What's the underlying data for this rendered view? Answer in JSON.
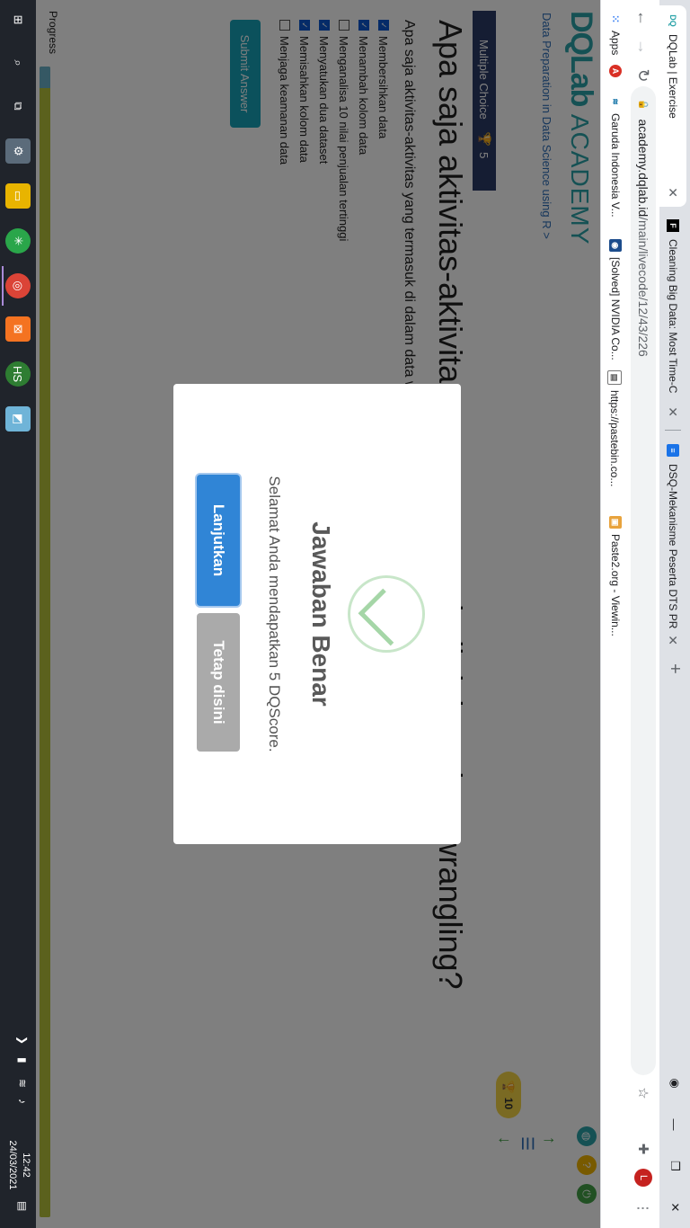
{
  "browser": {
    "tabs": [
      {
        "label": "DQLab | Exercise",
        "favicon": "DQ",
        "active": true
      },
      {
        "label": "Cleaning Big Data: Most Time-C",
        "favicon": "F",
        "active": false
      },
      {
        "label": "DSQ-Mekanisme Peserta DTS PR",
        "favicon": "≡",
        "active": false
      }
    ],
    "url_host": "academy.dqlab.id",
    "url_path": "/main/livecode/12/43/226",
    "bookmarks": [
      {
        "label": "Apps",
        "icon": "apps-grid-icon"
      },
      {
        "label": "",
        "icon": "red-badge-icon"
      },
      {
        "label": "Garuda Indonesia V...",
        "icon": "garuda-icon"
      },
      {
        "label": "[Solved] NVIDIA Co...",
        "icon": "nvidia-icon"
      },
      {
        "label": "https://pastebin.co...",
        "icon": "pastebin-icon"
      },
      {
        "label": "Paste2.org - Viewin...",
        "icon": "paste2-icon"
      }
    ],
    "profile_initial": "L"
  },
  "page": {
    "logo_main": "DQLab",
    "logo_sub": "ACADEMY",
    "breadcrumb": "Data Preparation in Data Science using R >",
    "score_total": "10",
    "question_type": "Multiple Choice",
    "question_points": "5",
    "question_title": "Apa saja aktivitas-aktivitas yang termasuk di dalam data wrangling?",
    "question_text": "Apa saja aktivitas-aktivitas yang termasuk di dalam data wrangling?",
    "options": [
      {
        "label": "Membersihkan data",
        "checked": true
      },
      {
        "label": "Menambah kolom data",
        "checked": true
      },
      {
        "label": "Menganalisa 10 nilai penjualan tertinggi",
        "checked": false
      },
      {
        "label": "Menyatukan dua dataset",
        "checked": true
      },
      {
        "label": "Memisahkan kolom data",
        "checked": true
      },
      {
        "label": "Menjaga keamanan data",
        "checked": false
      }
    ],
    "submit_label": "Submit Answer",
    "progress_label": "Progress"
  },
  "modal": {
    "title": "Jawaban Benar",
    "message": "Selamat Anda mendapatkan 5 DQScore.",
    "primary_button": "Lanjutkan",
    "secondary_button": "Tetap disini"
  },
  "taskbar": {
    "time": "12:42",
    "date": "24/03/2021"
  },
  "colors": {
    "brand": "#2aa3a8",
    "modal_primary": "#3085d6",
    "modal_secondary": "#aaaaaa",
    "banner": "#2b3a67",
    "score_badge": "#f5d547"
  }
}
